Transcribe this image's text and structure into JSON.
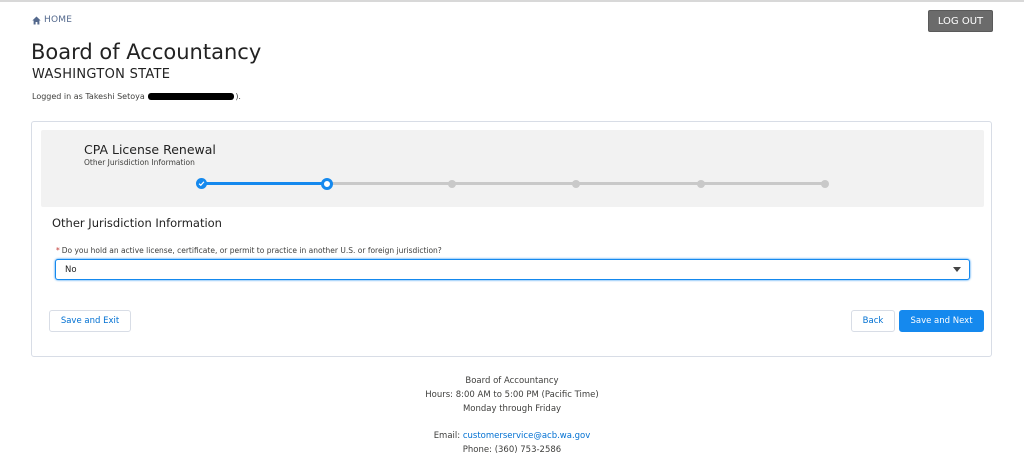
{
  "nav": {
    "home_label": "HOME",
    "logout_label": "LOG OUT"
  },
  "header": {
    "title": "Board of Accountancy",
    "subtitle": "WASHINGTON STATE",
    "logged_prefix": "Logged in as Takeshi Setoya",
    "logged_suffix": ")."
  },
  "wizard": {
    "title": "CPA License Renewal",
    "current_step": "Other Jurisdiction Information",
    "step_count": 6,
    "current_index": 1
  },
  "form": {
    "section_title": "Other Jurisdiction Information",
    "required_marker": "*",
    "question_label": "Do you hold an active license, certificate, or permit to practice in another U.S. or foreign jurisdiction?",
    "selected_value": "No"
  },
  "buttons": {
    "save_exit": "Save and Exit",
    "back": "Back",
    "save_next": "Save and Next"
  },
  "footer": {
    "org": "Board of Accountancy",
    "hours": "Hours: 8:00 AM to 5:00 PM (Pacific Time)",
    "days": "Monday through Friday",
    "email_label": "Email:",
    "email": "customerservice@acb.wa.gov",
    "phone": "Phone: (360) 753-2586"
  },
  "colors": {
    "brand": "#1589ee",
    "track": "#c9c9c9",
    "panel": "#f2f2f2",
    "logout": "#6b6b6b",
    "link": "#0070d2"
  },
  "icons": {
    "home": "home-icon",
    "check": "check-icon",
    "dropdown": "chevron-down-icon"
  }
}
